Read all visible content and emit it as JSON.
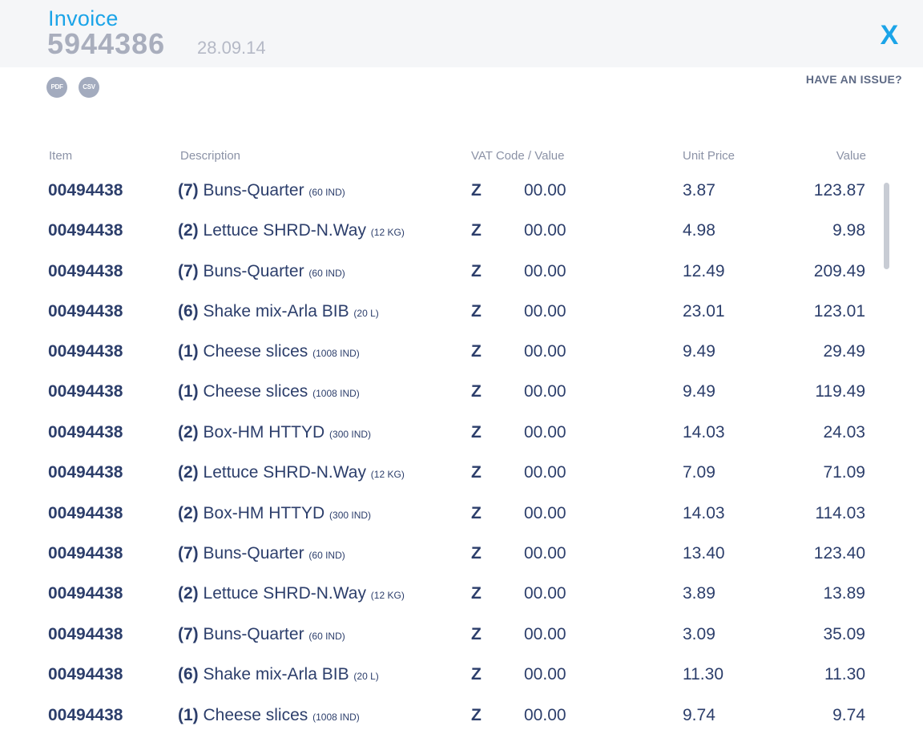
{
  "header": {
    "title": "Invoice",
    "invoice_number": "5944386",
    "date": "28.09.14",
    "close_label": "X"
  },
  "downloads": {
    "pdf_label": "PDF",
    "csv_label": "CSV"
  },
  "issue_link": "HAVE AN ISSUE?",
  "columns": {
    "item": "Item",
    "description": "Description",
    "vat": "VAT Code / Value",
    "unit_price": "Unit Price",
    "value": "Value"
  },
  "rows": [
    {
      "item": "00494438",
      "qty": "(7)",
      "name": "Buns-Quarter",
      "unit": "(60 IND)",
      "vat_code": "Z",
      "vat_value": "00.00",
      "unit_price": "3.87",
      "value": "123.87"
    },
    {
      "item": "00494438",
      "qty": "(2)",
      "name": "Lettuce SHRD-N.Way",
      "unit": "(12 KG)",
      "vat_code": "Z",
      "vat_value": "00.00",
      "unit_price": "4.98",
      "value": "9.98"
    },
    {
      "item": "00494438",
      "qty": "(7)",
      "name": "Buns-Quarter",
      "unit": "(60 IND)",
      "vat_code": "Z",
      "vat_value": "00.00",
      "unit_price": "12.49",
      "value": "209.49"
    },
    {
      "item": "00494438",
      "qty": "(6)",
      "name": "Shake mix-Arla BIB",
      "unit": "(20 L)",
      "vat_code": "Z",
      "vat_value": "00.00",
      "unit_price": "23.01",
      "value": "123.01"
    },
    {
      "item": "00494438",
      "qty": "(1)",
      "name": "Cheese slices",
      "unit": "(1008 IND)",
      "vat_code": "Z",
      "vat_value": "00.00",
      "unit_price": "9.49",
      "value": "29.49"
    },
    {
      "item": "00494438",
      "qty": "(1)",
      "name": "Cheese slices",
      "unit": "(1008 IND)",
      "vat_code": "Z",
      "vat_value": "00.00",
      "unit_price": "9.49",
      "value": "119.49"
    },
    {
      "item": "00494438",
      "qty": "(2)",
      "name": "Box-HM HTTYD",
      "unit": "(300 IND)",
      "vat_code": "Z",
      "vat_value": "00.00",
      "unit_price": "14.03",
      "value": "24.03"
    },
    {
      "item": "00494438",
      "qty": "(2)",
      "name": "Lettuce SHRD-N.Way",
      "unit": "(12 KG)",
      "vat_code": "Z",
      "vat_value": "00.00",
      "unit_price": "7.09",
      "value": "71.09"
    },
    {
      "item": "00494438",
      "qty": "(2)",
      "name": "Box-HM HTTYD",
      "unit": "(300 IND)",
      "vat_code": "Z",
      "vat_value": "00.00",
      "unit_price": "14.03",
      "value": "114.03"
    },
    {
      "item": "00494438",
      "qty": "(7)",
      "name": "Buns-Quarter",
      "unit": "(60 IND)",
      "vat_code": "Z",
      "vat_value": "00.00",
      "unit_price": "13.40",
      "value": "123.40"
    },
    {
      "item": "00494438",
      "qty": "(2)",
      "name": "Lettuce SHRD-N.Way",
      "unit": "(12 KG)",
      "vat_code": "Z",
      "vat_value": "00.00",
      "unit_price": "3.89",
      "value": "13.89"
    },
    {
      "item": "00494438",
      "qty": "(7)",
      "name": "Buns-Quarter",
      "unit": "(60 IND)",
      "vat_code": "Z",
      "vat_value": "00.00",
      "unit_price": "3.09",
      "value": "35.09"
    },
    {
      "item": "00494438",
      "qty": "(6)",
      "name": "Shake mix-Arla BIB",
      "unit": "(20 L)",
      "vat_code": "Z",
      "vat_value": "00.00",
      "unit_price": "11.30",
      "value": "11.30"
    },
    {
      "item": "00494438",
      "qty": "(1)",
      "name": "Cheese slices",
      "unit": "(1008 IND)",
      "vat_code": "Z",
      "vat_value": "00.00",
      "unit_price": "9.74",
      "value": "9.74"
    }
  ]
}
